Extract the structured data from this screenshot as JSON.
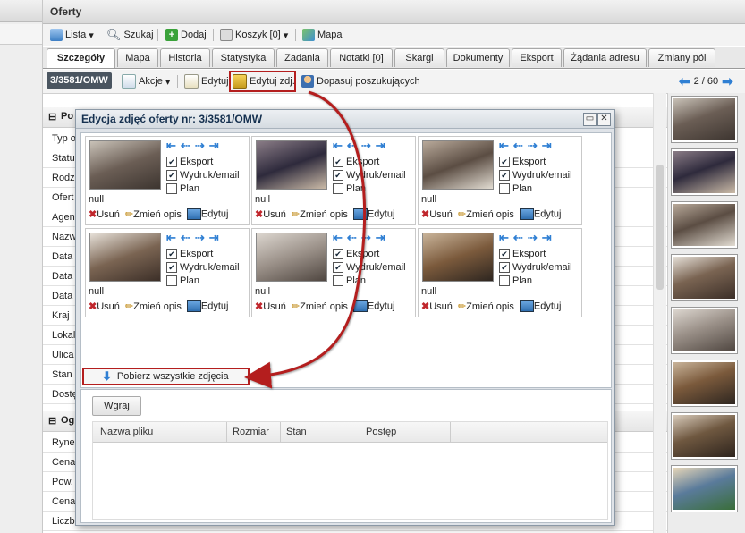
{
  "window": {
    "title": "Oferty"
  },
  "toolbar": {
    "lista": "Lista",
    "szukaj": "Szukaj",
    "dodaj": "Dodaj",
    "koszyk": "Koszyk [0]",
    "mapa": "Mapa"
  },
  "tabs": [
    "Szczegóły",
    "Mapa",
    "Historia",
    "Statystyka",
    "Zadania",
    "Notatki [0]",
    "Skargi",
    "Dokumenty",
    "Eksport",
    "Żądania adresu",
    "Zmiany pól"
  ],
  "actionbar": {
    "offer_id": "3/3581/OMW",
    "akcje": "Akcje",
    "edytuj": "Edytuj",
    "edytuj_zdj": "Edytuj zdj.",
    "dopasuj": "Dopasuj poszukujących",
    "pager": "2 / 60"
  },
  "form": {
    "section1": "Po",
    "labels": [
      "Typ o",
      "Statu",
      "Rodz",
      "Ofert",
      "Agen",
      "Nazw",
      "Data",
      "Data",
      "Data",
      "Kraj",
      "Lokal",
      "Ulica",
      "Stan",
      "Dostę"
    ],
    "section2": "Og",
    "labels2": [
      "Ryne",
      "Cena",
      "Pow.",
      "Cena",
      "Liczb"
    ]
  },
  "modal": {
    "title": "Edycja zdjęć oferty nr: 3/3581/OMW",
    "photos": [
      {
        "eksport": true,
        "wydruk": true,
        "plan": false,
        "desc": "null",
        "palette": [
          "#6b5e55",
          "#c9c2b8",
          "#3d3530"
        ]
      },
      {
        "eksport": true,
        "wydruk": true,
        "plan": false,
        "desc": "null",
        "palette": [
          "#2e2a3c",
          "#8a7c86",
          "#cbbba8"
        ]
      },
      {
        "eksport": true,
        "wydruk": true,
        "plan": false,
        "desc": "null",
        "palette": [
          "#5b4d43",
          "#b8a99a",
          "#e2dcd2"
        ]
      },
      {
        "eksport": true,
        "wydruk": true,
        "plan": false,
        "desc": "null",
        "palette": [
          "#7a6452",
          "#e6e0d8",
          "#3c2f28"
        ]
      },
      {
        "eksport": true,
        "wydruk": true,
        "plan": false,
        "desc": "null",
        "palette": [
          "#9a9088",
          "#dcd6cf",
          "#4f4640"
        ]
      },
      {
        "eksport": true,
        "wydruk": true,
        "plan": false,
        "desc": "null",
        "palette": [
          "#7b5a3c",
          "#c9b49a",
          "#2e2620"
        ]
      }
    ],
    "labels": {
      "eksport": "Eksport",
      "wydruk": "Wydruk/email",
      "plan": "Plan",
      "usun": "Usuń",
      "zmien": "Zmień opis",
      "edytuj": "Edytuj"
    },
    "download_all": "Pobierz wszystkie zdjęcia",
    "upload_button": "Wgraj",
    "upload_columns": [
      "Nazwa pliku",
      "Rozmiar",
      "Stan",
      "Postęp"
    ]
  },
  "colors": {
    "accent_red": "#b41e1e",
    "link_blue": "#2f7fd3"
  }
}
